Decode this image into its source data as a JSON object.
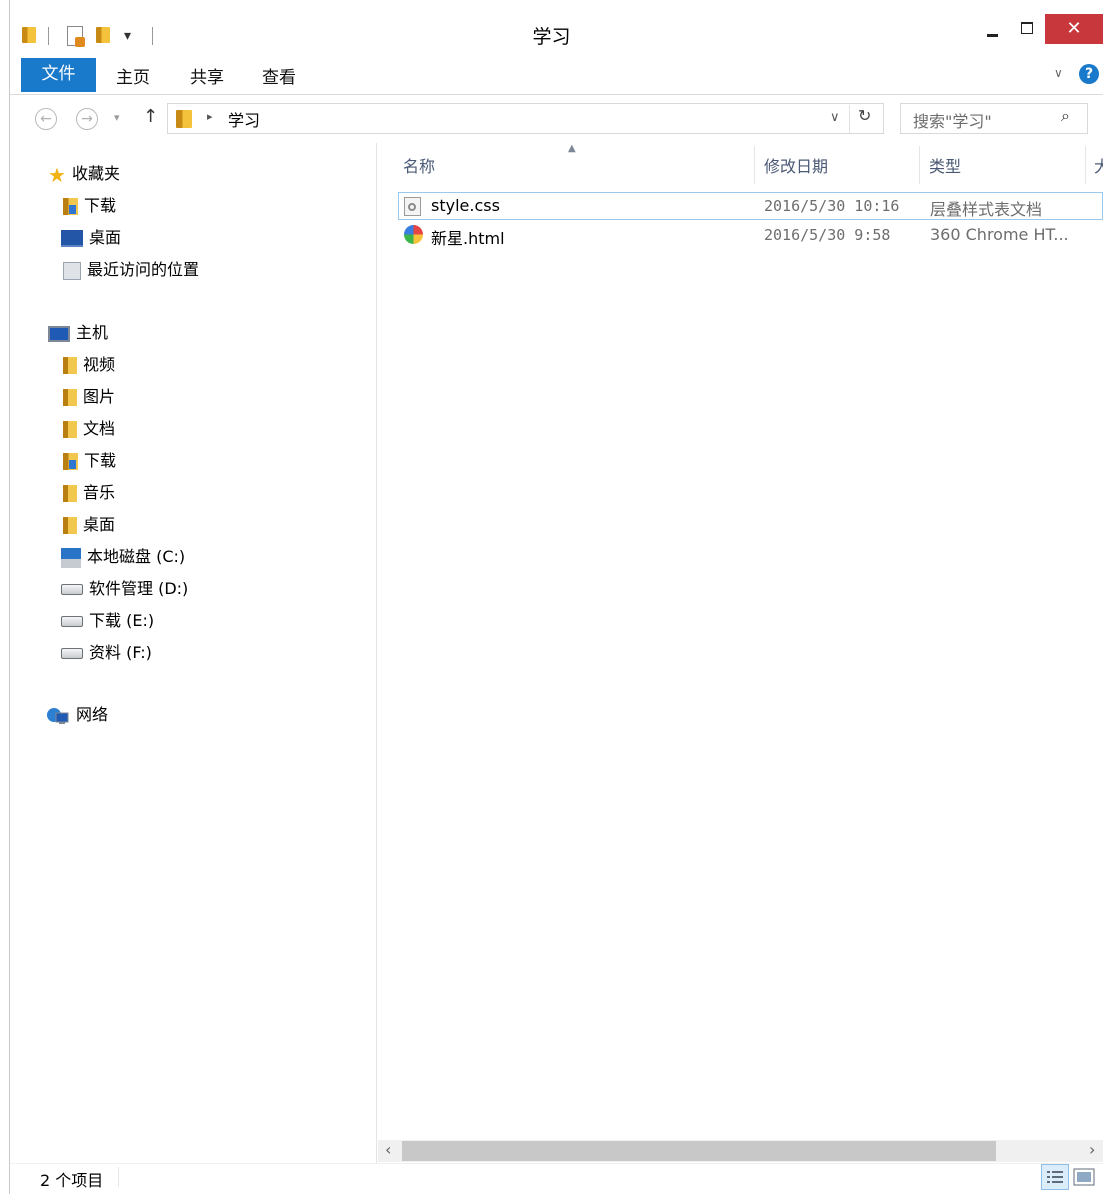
{
  "window": {
    "title": "学习",
    "close_glyph": "✕"
  },
  "ribbon": {
    "tabs": [
      {
        "label": "文件"
      },
      {
        "label": "主页"
      },
      {
        "label": "共享"
      },
      {
        "label": "查看"
      }
    ],
    "file_tab_color": "#1979ca"
  },
  "address": {
    "crumb": "学习",
    "search_placeholder": "搜索\"学习\""
  },
  "nav_pane": {
    "favorites": {
      "label": "收藏夹",
      "items": [
        {
          "label": "下载",
          "icon": "download-folder-icon"
        },
        {
          "label": "桌面",
          "icon": "desktop-icon"
        },
        {
          "label": "最近访问的位置",
          "icon": "recent-places-icon"
        }
      ]
    },
    "computer": {
      "label": "主机",
      "items": [
        {
          "label": "视频",
          "icon": "videos-folder-icon"
        },
        {
          "label": "图片",
          "icon": "pictures-folder-icon"
        },
        {
          "label": "文档",
          "icon": "documents-folder-icon"
        },
        {
          "label": "下载",
          "icon": "download-folder-icon"
        },
        {
          "label": "音乐",
          "icon": "music-folder-icon"
        },
        {
          "label": "桌面",
          "icon": "desktop-folder-icon"
        },
        {
          "label": "本地磁盘 (C:)",
          "icon": "local-disk-icon"
        },
        {
          "label": "软件管理 (D:)",
          "icon": "drive-icon"
        },
        {
          "label": "下载 (E:)",
          "icon": "drive-icon"
        },
        {
          "label": "资料 (F:)",
          "icon": "drive-icon"
        }
      ]
    },
    "network": {
      "label": "网络"
    }
  },
  "file_list": {
    "columns": {
      "name": "名称",
      "modified": "修改日期",
      "type": "类型",
      "size_partial": "大"
    },
    "rows": [
      {
        "name": "style.css",
        "modified": "2016/5/30 10:16",
        "type": "层叠样式表文档",
        "icon": "css-file-icon"
      },
      {
        "name": "新星.html",
        "modified": "2016/5/30 9:58",
        "type": "360 Chrome HT...",
        "icon": "chrome-html-file-icon"
      }
    ]
  },
  "status": {
    "item_count": "2 个项目"
  }
}
